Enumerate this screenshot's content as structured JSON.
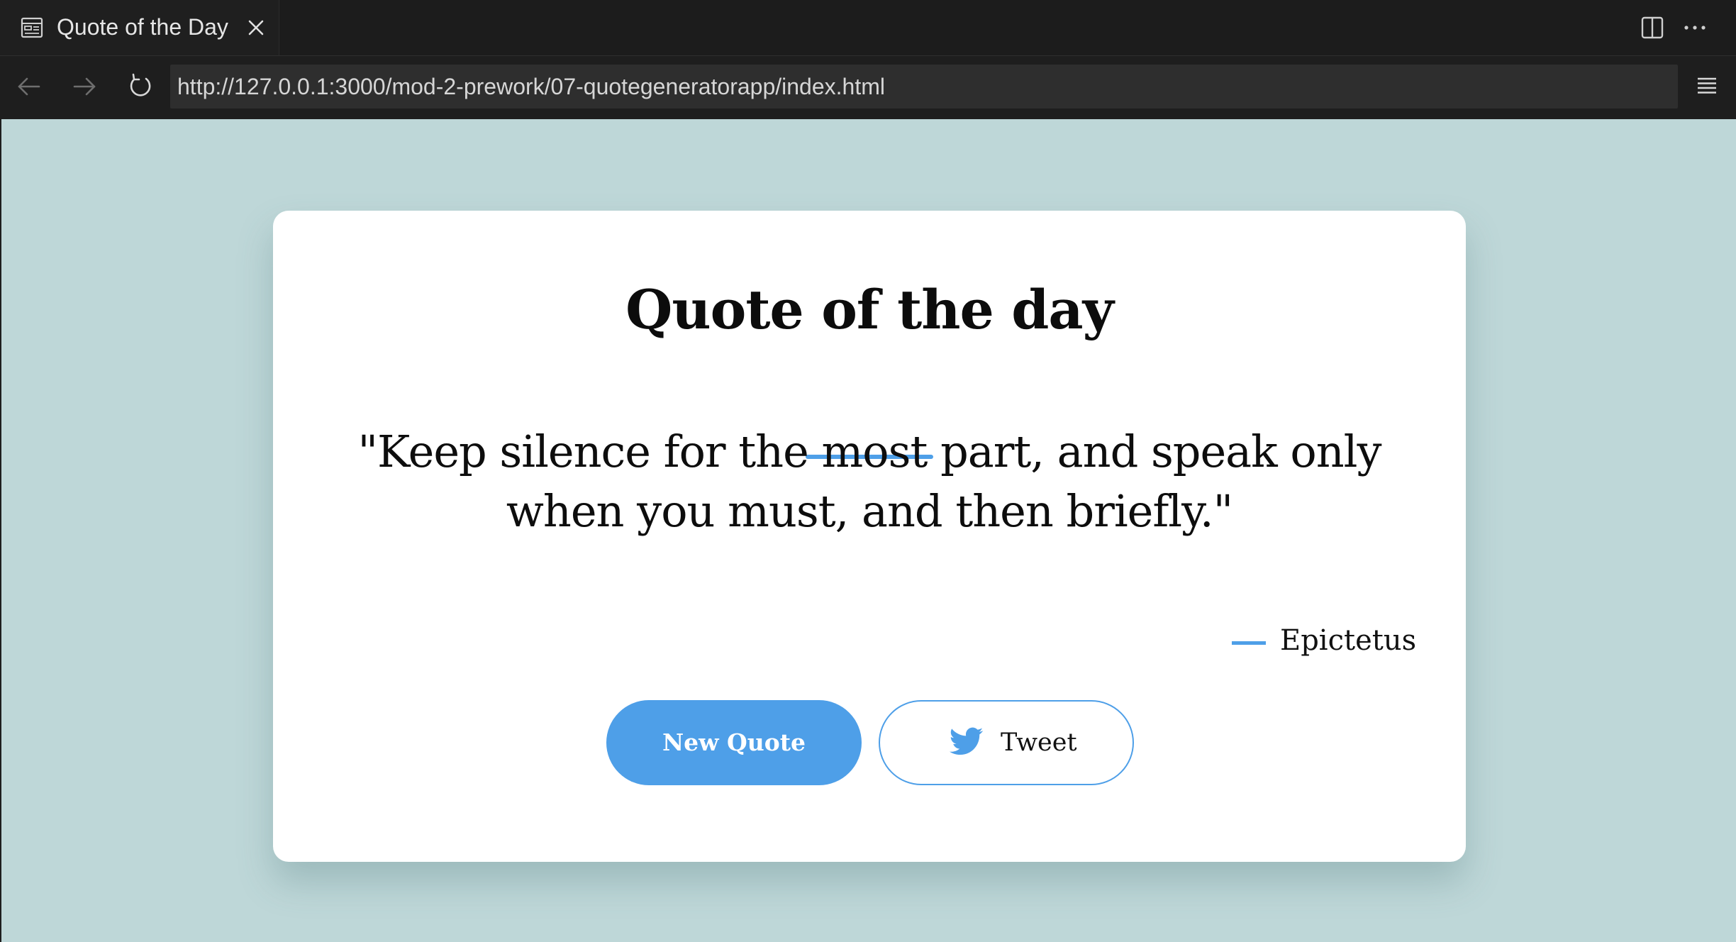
{
  "browser": {
    "tab": {
      "title": "Quote of the Day",
      "icon": "page-preview-icon",
      "close_icon": "close-icon"
    },
    "tabbar_actions": [
      "split-editor-icon",
      "more-actions-icon"
    ],
    "nav": {
      "back_icon": "back-arrow-icon",
      "forward_icon": "forward-arrow-icon",
      "reload_icon": "reload-icon",
      "menu_icon": "hamburger-menu-icon"
    },
    "address_bar": {
      "url": "http://127.0.0.1:3000/mod-2-prework/07-quotegeneratorapp/index.html"
    }
  },
  "page": {
    "background_color": "#bed7d8",
    "accent_color": "#4e9fe8",
    "card": {
      "heading": "Quote of the day",
      "quote": "\"Keep silence for the most part, and speak only when you must, and then briefly.\"",
      "author": "Epictetus",
      "new_quote_label": "New Quote",
      "tweet_label": "Tweet",
      "tweet_icon": "twitter-bird-icon"
    }
  }
}
